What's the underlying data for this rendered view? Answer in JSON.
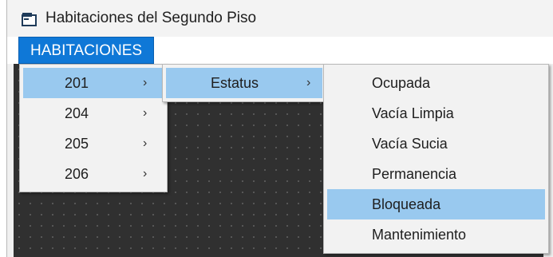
{
  "window": {
    "title": "Habitaciones del Segundo Piso"
  },
  "menubar": {
    "habitaciones_label": "HABITACIONES"
  },
  "rooms_menu": {
    "items": [
      {
        "label": "201",
        "selected": true
      },
      {
        "label": "204",
        "selected": false
      },
      {
        "label": "205",
        "selected": false
      },
      {
        "label": "206",
        "selected": false
      }
    ],
    "submenu_arrow": "›"
  },
  "room_submenu": {
    "items": [
      {
        "label": "Estatus",
        "selected": true
      }
    ],
    "submenu_arrow": "›"
  },
  "status_menu": {
    "items": [
      {
        "label": "Ocupada",
        "selected": false
      },
      {
        "label": "Vacía Limpia",
        "selected": false
      },
      {
        "label": "Vacía Sucia",
        "selected": false
      },
      {
        "label": "Permanencia",
        "selected": false
      },
      {
        "label": "Bloqueada",
        "selected": true
      },
      {
        "label": "Mantenimiento",
        "selected": false
      }
    ]
  },
  "colors": {
    "menu_highlight": "#99c9ef",
    "menubar_active": "#0f78d7",
    "client_background": "#303030"
  },
  "icons": {
    "title": "window-app-icon"
  }
}
